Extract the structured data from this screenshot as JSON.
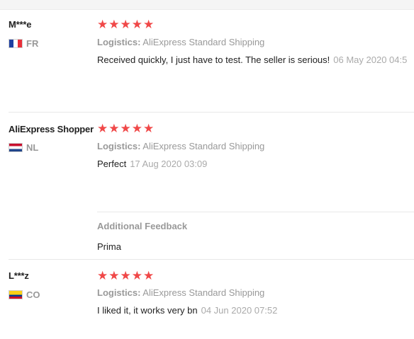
{
  "reviews": [
    {
      "user": "M***e",
      "country": "FR",
      "flag": [
        "#1e3fa0",
        "#ffffff",
        "#e8303a"
      ],
      "stars": "★★★★★",
      "logistics_label": "Logistics:",
      "logistics_value": " AliExpress Standard Shipping",
      "text": "Received quickly, I just have to test. The seller is serious!",
      "date": "06 May 2020 04:5"
    },
    {
      "user": "AliExpress Shopper",
      "country": "NL",
      "flag": [
        "#c8102e",
        "#ffffff",
        "#21468b"
      ],
      "stars": "★★★★★",
      "logistics_label": "Logistics:",
      "logistics_value": " AliExpress Standard Shipping",
      "text": "Perfect",
      "date": "17 Aug 2020 03:09",
      "additional_feedback_title": "Additional Feedback",
      "additional_feedback_text": "Prima"
    },
    {
      "user": "L***z",
      "country": "CO",
      "flag": [
        "#fcd116",
        "#003893",
        "#ce1126"
      ],
      "stars": "★★★★★",
      "logistics_label": "Logistics:",
      "logistics_value": " AliExpress Standard Shipping",
      "text": "I liked it, it works very bn",
      "date": "04 Jun 2020 07:52"
    }
  ]
}
